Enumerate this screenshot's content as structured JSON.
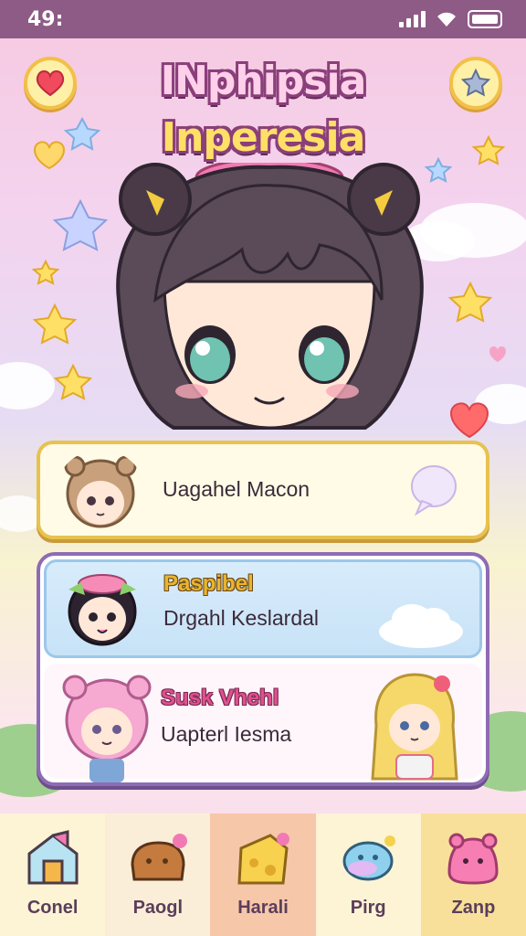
{
  "status_bar": {
    "time": "49:"
  },
  "header": {
    "title_line1": "INphipsia",
    "title_line2": "Inperesia",
    "left_button_icon": "heart-icon",
    "right_button_icon": "star-icon"
  },
  "cards": [
    {
      "line1": "Uagahel Macon",
      "icon": "speech-bubble-icon"
    },
    {
      "name": "Paspibel",
      "line2": "Drgahl Keslardal",
      "name_color": "#e9b52c"
    },
    {
      "name": "Susk Vhehl",
      "line2": "Uapterl Iesma",
      "name_color": "#e0508e"
    }
  ],
  "nav": {
    "items": [
      {
        "label": "Conel",
        "icon": "house-icon"
      },
      {
        "label": "Paogl",
        "icon": "bread-icon"
      },
      {
        "label": "Harali",
        "icon": "cheese-icon"
      },
      {
        "label": "Pirg",
        "icon": "fish-icon"
      },
      {
        "label": "Zanp",
        "icon": "jelly-icon"
      }
    ],
    "colors": [
      "#fdf4d6",
      "#fbeed8",
      "#f7c7a9",
      "#fdf4d6",
      "#f9e09a"
    ]
  },
  "colors": {
    "status_bar": "#8e5a86",
    "title_outline": "#8a3f7a",
    "card_border_yellow": "#e7c24f",
    "card_border_purple": "#8f6bb4"
  }
}
